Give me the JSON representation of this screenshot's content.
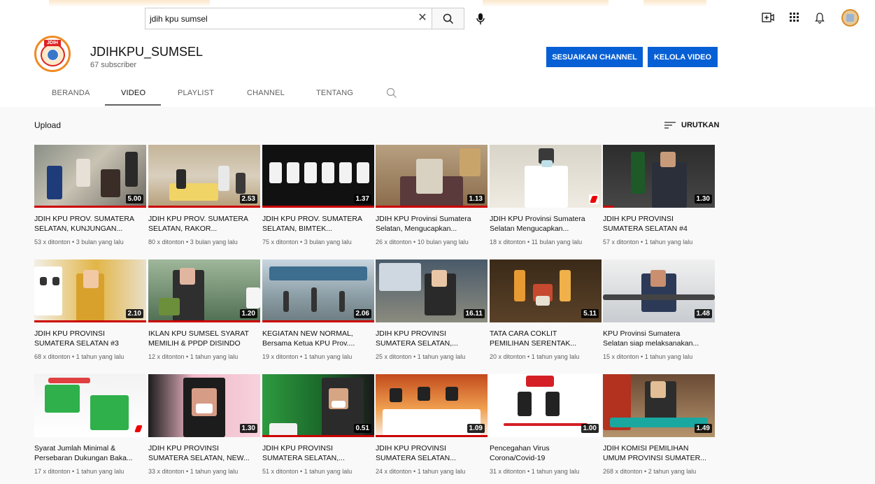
{
  "search": {
    "query": "jdih kpu sumsel"
  },
  "channel": {
    "logo_text": "JDIH",
    "name": "JDIHKPU_SUMSEL",
    "subscribers": "67 subscriber",
    "customize_label": "SESUAIKAN CHANNEL",
    "manage_label": "KELOLA VIDEO"
  },
  "tabs": [
    "BERANDA",
    "VIDEO",
    "PLAYLIST",
    "CHANNEL",
    "TENTANG"
  ],
  "section": {
    "title": "Upload",
    "sort_label": "URUTKAN"
  },
  "colors": {
    "accent_blue": "#065fd4",
    "progress_red": "#cc0000",
    "brand_orange": "#f08a22"
  },
  "icons": [
    "search-icon",
    "clear-icon",
    "mic-icon",
    "create-video-icon",
    "apps-icon",
    "bell-icon",
    "sort-icon"
  ],
  "videos": [
    {
      "title_l1": "JDIH KPU PROV. SUMATERA",
      "title_l2": "SELATAN, KUNJUNGAN...",
      "meta": "53 x ditonton • 3 bulan yang lalu",
      "duration": "5.00",
      "shorts": false,
      "watched": 1.0
    },
    {
      "title_l1": "JDIH KPU PROV. SUMATERA",
      "title_l2": "SELATAN, RAKOR...",
      "meta": "80 x ditonton • 3 bulan yang lalu",
      "duration": "2.53",
      "shorts": false,
      "watched": 1.0
    },
    {
      "title_l1": "JDIH KPU PROV. SUMATERA",
      "title_l2": "SELATAN, BIMTEK...",
      "meta": "75 x ditonton • 3 bulan yang lalu",
      "duration": "1.37",
      "shorts": false,
      "watched": 1.0
    },
    {
      "title_l1": "JDIH KPU Provinsi Sumatera",
      "title_l2": "Selatan, Mengucapkan...",
      "meta": "26 x ditonton • 10 bulan yang lalu",
      "duration": "1.13",
      "shorts": false,
      "watched": 1.0
    },
    {
      "title_l1": "JDIH KPU Provinsi Sumatera",
      "title_l2": "Selatan Mengucapkan...",
      "meta": "18 x ditonton • 11 bulan yang lalu",
      "duration": "",
      "shorts": true,
      "watched": 0.0
    },
    {
      "title_l1": "JDIH KPU PROVINSI",
      "title_l2": "SUMATERA SELATAN #4",
      "meta": "57 x ditonton • 1 tahun yang lalu",
      "duration": "1.30",
      "shorts": false,
      "watched": 0.1
    },
    {
      "title_l1": "JDIH KPU PROVINSI",
      "title_l2": "SUMATERA SELATAN #3",
      "meta": "68 x ditonton • 1 tahun yang lalu",
      "duration": "2.10",
      "shorts": false,
      "watched": 1.0
    },
    {
      "title_l1": "IKLAN KPU SUMSEL SYARAT",
      "title_l2": "MEMILIH & PPDP DISINDO",
      "meta": "12 x ditonton • 1 tahun yang lalu",
      "duration": "1.20",
      "shorts": false,
      "watched": 1.0
    },
    {
      "title_l1": "KEGIATAN NEW NORMAL,",
      "title_l2": "Bersama Ketua KPU Prov....",
      "meta": "19 x ditonton • 1 tahun yang lalu",
      "duration": "2.06",
      "shorts": false,
      "watched": 1.0
    },
    {
      "title_l1": "JDIH KPU PROVINSI",
      "title_l2": "SUMATERA SELATAN,...",
      "meta": "25 x ditonton • 1 tahun yang lalu",
      "duration": "16.11",
      "shorts": false,
      "watched": 0.0
    },
    {
      "title_l1": "TATA CARA COKLIT",
      "title_l2": "PEMILIHAN SERENTAK...",
      "meta": "20 x ditonton • 1 tahun yang lalu",
      "duration": "5.11",
      "shorts": false,
      "watched": 0.0
    },
    {
      "title_l1": "KPU Provinsi Sumatera",
      "title_l2": "Selatan siap melaksanakan...",
      "meta": "15 x ditonton • 1 tahun yang lalu",
      "duration": "1.48",
      "shorts": false,
      "watched": 0.0
    },
    {
      "title_l1": "Syarat Jumlah Minimal &",
      "title_l2": "Persebaran Dukungan Baka...",
      "meta": "17 x ditonton • 1 tahun yang lalu",
      "duration": "",
      "shorts": true,
      "watched": 0.0
    },
    {
      "title_l1": "JDIH KPU PROVINSI",
      "title_l2": "SUMATERA SELATAN, NEW...",
      "meta": "33 x ditonton • 1 tahun yang lalu",
      "duration": "1.30",
      "shorts": false,
      "watched": 0.0
    },
    {
      "title_l1": "JDIH KPU PROVINSI",
      "title_l2": "SUMATERA SELATAN,...",
      "meta": "51 x ditonton • 1 tahun yang lalu",
      "duration": "0.51",
      "shorts": false,
      "watched": 1.0
    },
    {
      "title_l1": "JDIH KPU PROVINSI",
      "title_l2": "SUMATERA SELATAN...",
      "meta": "24 x ditonton • 1 tahun yang lalu",
      "duration": "1.09",
      "shorts": false,
      "watched": 1.0
    },
    {
      "title_l1": "Pencegahan Virus",
      "title_l2": "Corona/Covid-19",
      "meta": "31 x ditonton • 1 tahun yang lalu",
      "duration": "1.00",
      "shorts": false,
      "watched": 0.0
    },
    {
      "title_l1": "JDIH KOMISI PEMILIHAN",
      "title_l2": "UMUM PROVINSI SUMATER...",
      "meta": "268 x ditonton • 2 tahun yang lalu",
      "duration": "1.49",
      "shorts": false,
      "watched": 0.0
    }
  ]
}
